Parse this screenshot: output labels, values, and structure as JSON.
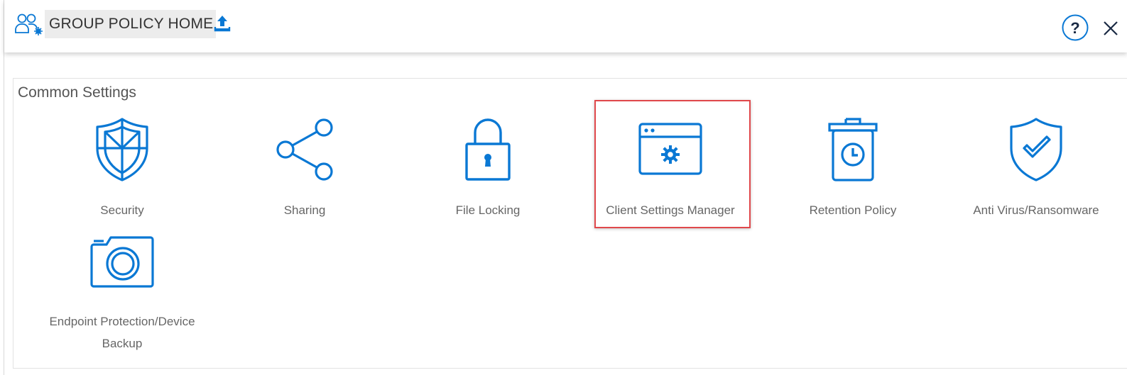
{
  "header": {
    "title": "GROUP POLICY HOME",
    "icons": {
      "group": "users-gear-icon",
      "upload": "upload-icon",
      "help": "help-circle-icon",
      "close": "close-icon"
    },
    "help_label": "?",
    "close_label": "×"
  },
  "section": {
    "title": "Common Settings",
    "accent_color": "#0a78d4",
    "highlight_color": "#e0484b",
    "items": [
      {
        "label": "Security",
        "icon": "shield-icon"
      },
      {
        "label": "Sharing",
        "icon": "share-icon"
      },
      {
        "label": "File Locking",
        "icon": "lock-icon"
      },
      {
        "label": "Client Settings Manager",
        "icon": "window-gear-icon",
        "highlighted": true
      },
      {
        "label": "Retention Policy",
        "icon": "trash-clock-icon"
      },
      {
        "label": "Anti Virus/Ransomware",
        "icon": "shield-check-icon"
      },
      {
        "label": "Endpoint Protection/Device Backup",
        "icon": "camera-icon"
      }
    ]
  }
}
